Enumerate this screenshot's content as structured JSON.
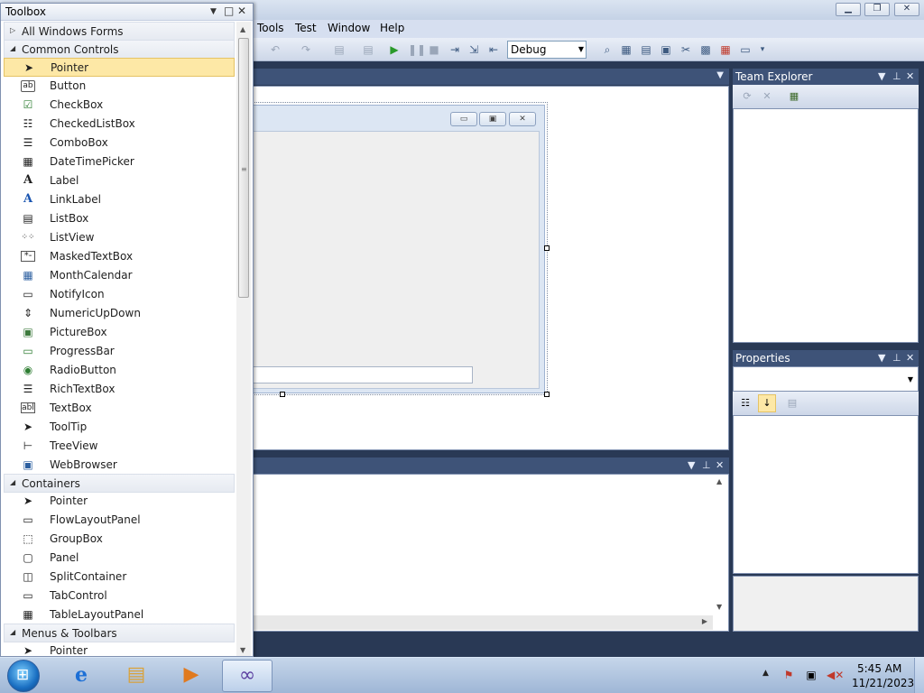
{
  "toolbox": {
    "title": "Toolbox",
    "groups": [
      {
        "label": "All Windows Forms",
        "expanded": false
      },
      {
        "label": "Common Controls",
        "expanded": true
      },
      {
        "label": "Containers",
        "expanded": true
      },
      {
        "label": "Menus & Toolbars",
        "expanded": true
      }
    ],
    "common_controls": [
      {
        "label": "Pointer",
        "icon": "pointer-icon",
        "selected": true
      },
      {
        "label": "Button",
        "icon": "button-icon"
      },
      {
        "label": "CheckBox",
        "icon": "checkbox-icon"
      },
      {
        "label": "CheckedListBox",
        "icon": "checkedlistbox-icon"
      },
      {
        "label": "ComboBox",
        "icon": "combobox-icon"
      },
      {
        "label": "DateTimePicker",
        "icon": "datetimepicker-icon"
      },
      {
        "label": "Label",
        "icon": "label-icon"
      },
      {
        "label": "LinkLabel",
        "icon": "linklabel-icon"
      },
      {
        "label": "ListBox",
        "icon": "listbox-icon"
      },
      {
        "label": "ListView",
        "icon": "listview-icon"
      },
      {
        "label": "MaskedTextBox",
        "icon": "maskedtextbox-icon"
      },
      {
        "label": "MonthCalendar",
        "icon": "monthcalendar-icon"
      },
      {
        "label": "NotifyIcon",
        "icon": "notifyicon-icon"
      },
      {
        "label": "NumericUpDown",
        "icon": "numericupdown-icon"
      },
      {
        "label": "PictureBox",
        "icon": "picturebox-icon"
      },
      {
        "label": "ProgressBar",
        "icon": "progressbar-icon"
      },
      {
        "label": "RadioButton",
        "icon": "radiobutton-icon"
      },
      {
        "label": "RichTextBox",
        "icon": "richtextbox-icon"
      },
      {
        "label": "TextBox",
        "icon": "textbox-icon"
      },
      {
        "label": "ToolTip",
        "icon": "tooltip-icon"
      },
      {
        "label": "TreeView",
        "icon": "treeview-icon"
      },
      {
        "label": "WebBrowser",
        "icon": "webbrowser-icon"
      }
    ],
    "containers": [
      {
        "label": "Pointer",
        "icon": "pointer-icon"
      },
      {
        "label": "FlowLayoutPanel",
        "icon": "flowlayoutpanel-icon"
      },
      {
        "label": "GroupBox",
        "icon": "groupbox-icon"
      },
      {
        "label": "Panel",
        "icon": "panel-icon"
      },
      {
        "label": "SplitContainer",
        "icon": "splitcontainer-icon"
      },
      {
        "label": "TabControl",
        "icon": "tabcontrol-icon"
      },
      {
        "label": "TableLayoutPanel",
        "icon": "tablelayoutpanel-icon"
      }
    ],
    "menus_toolbars": [
      {
        "label": "Pointer",
        "icon": "pointer-icon"
      }
    ]
  },
  "menu": {
    "tools": "Tools",
    "test": "Test",
    "window": "Window",
    "help": "Help"
  },
  "toolbar": {
    "config_value": "Debug"
  },
  "panels": {
    "team_explorer": "Team Explorer",
    "properties": "Properties"
  },
  "taskbar": {
    "time": "5:45 AM",
    "date": "11/21/2023",
    "apps": [
      "internet-explorer-icon",
      "file-explorer-icon",
      "media-player-icon",
      "visual-studio-icon"
    ]
  },
  "colors": {
    "ide_background": "#293955",
    "panel_header": "#3e5378",
    "selection": "#fde8a6"
  }
}
